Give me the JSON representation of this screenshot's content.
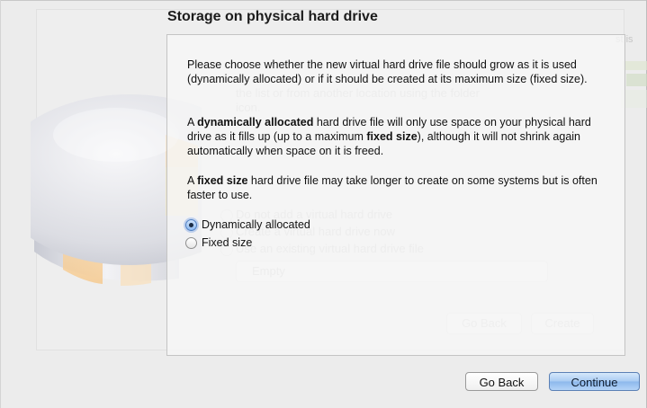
{
  "page": {
    "title": "Storage on physical hard drive"
  },
  "description": {
    "p1": "Please choose whether the new virtual hard drive file should grow as it is used (dynamically allocated) or if it should be created at its maximum size (fixed size).",
    "p2": {
      "part1": "A ",
      "bold1": "dynamically allocated",
      "part2": " hard drive file will only use space on your physical hard drive as it fills up (up to a maximum ",
      "bold2": "fixed size",
      "part3": "), although it will not shrink again automatically when space on it is freed."
    },
    "p3": {
      "part1": "A ",
      "bold1": "fixed size",
      "part2": " hard drive file may take longer to create on some systems but is often faster to use."
    }
  },
  "options": {
    "dynamic_label": "Dynamically allocated",
    "fixed_label": "Fixed size",
    "selected": "Dynamically allocated"
  },
  "buttons": {
    "go_back": "Go Back",
    "continue": "Continue"
  },
  "background_ghost": {
    "line1": "the list or from another location using the folder",
    "line2": "icon.",
    "option1": "Do not add a virtual hard drive",
    "option2": "Create a virtual hard drive now",
    "option3": "Use an existing virtual hard drive file",
    "combo_value": "Empty",
    "go_back": "Go Back",
    "create": "Create",
    "edge_text": "st is"
  },
  "colors": {
    "accent": "#8cb8ec",
    "window_bg": "#ececec",
    "panel_border": "#c4c4c4"
  }
}
